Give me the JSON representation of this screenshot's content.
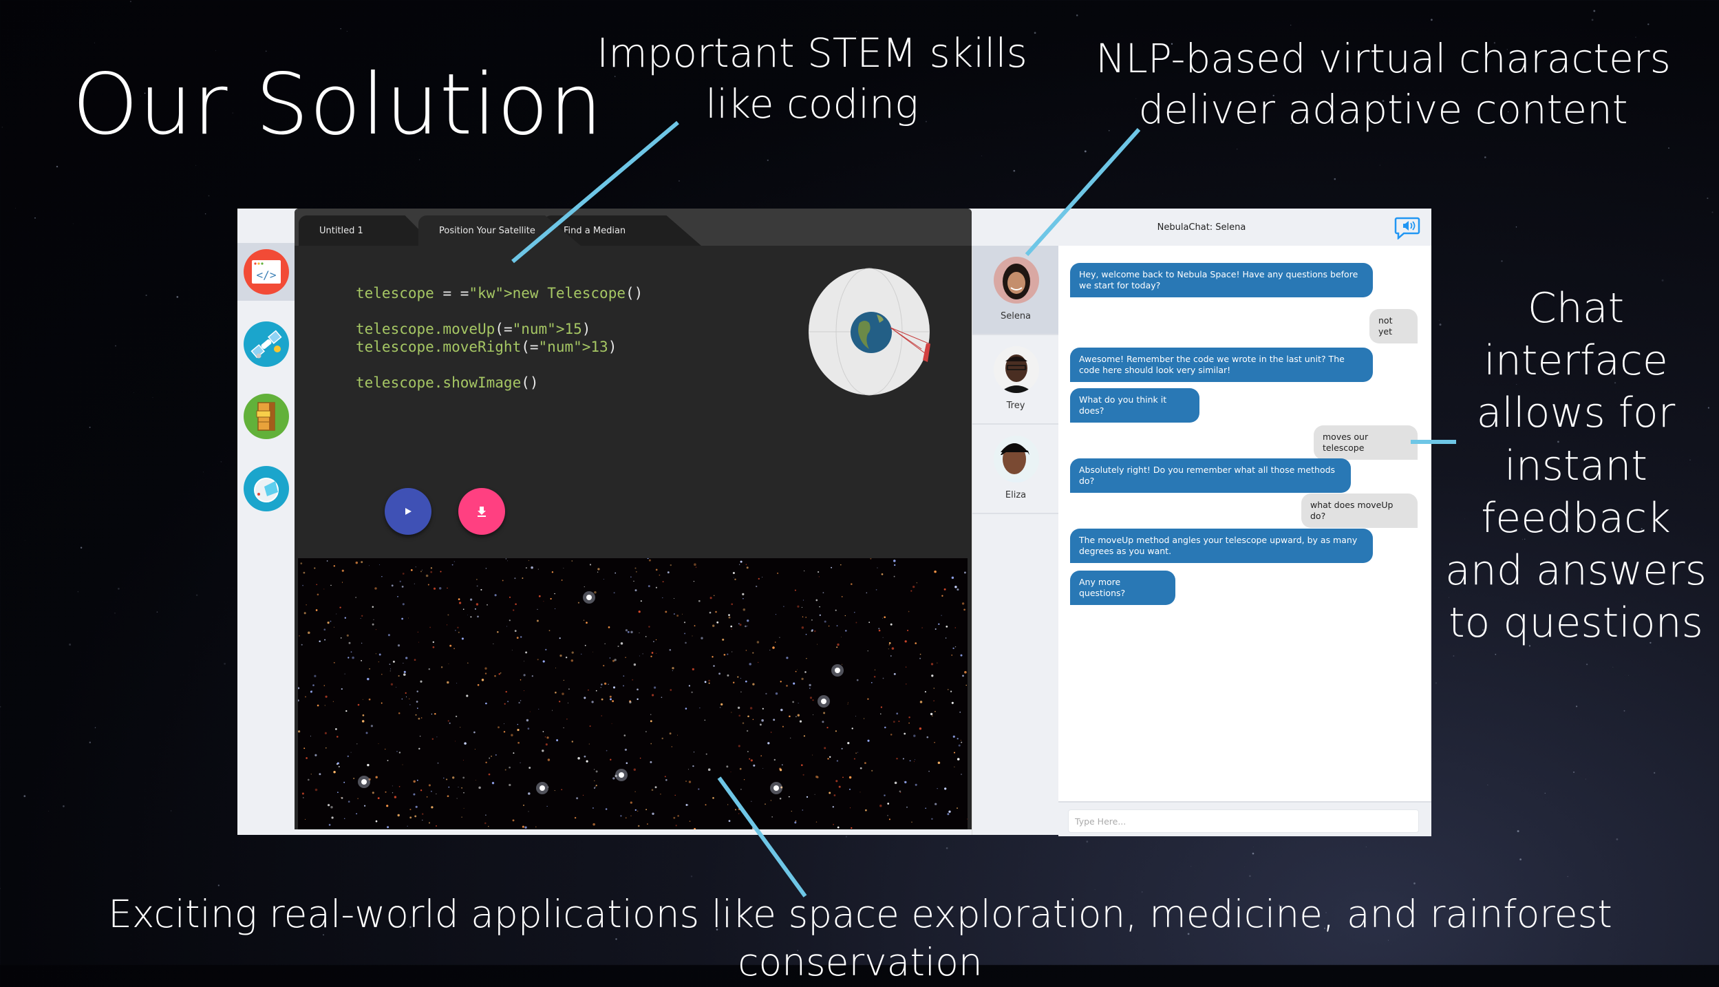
{
  "slide": {
    "title": "Our Solution",
    "callouts": {
      "stem": [
        "Important STEM skills",
        "like coding"
      ],
      "nlp": [
        "NLP-based virtual characters",
        "deliver adaptive content"
      ],
      "chat": [
        "Chat",
        "interface",
        "allows for",
        "instant",
        "feedback",
        "and answers",
        "to questions"
      ],
      "applications": "Exciting real-world applications like space exploration, medicine, and rainforest conservation"
    },
    "accent_color": "#6ec6e6"
  },
  "app": {
    "rail": [
      {
        "icon": "code-window-icon",
        "color": "#f24b36",
        "active": true
      },
      {
        "icon": "satellite-icon",
        "color": "#1ba5cc",
        "active": false
      },
      {
        "icon": "filing-cabinet-icon",
        "color": "#62b13a",
        "active": false
      },
      {
        "icon": "astronaut-helmet-icon",
        "color": "#1ba5cc",
        "active": false
      }
    ],
    "editor": {
      "tabs": [
        {
          "label": "Untitled 1",
          "active": false
        },
        {
          "label": "Position Your Satellite",
          "active": true
        },
        {
          "label": "Find a Median",
          "active": false
        }
      ],
      "code": [
        "telescope = new Telescope()",
        "",
        "telescope.moveUp(15)",
        "telescope.moveRight(13)",
        "",
        "telescope.showImage()"
      ],
      "run_button_icon": "play-icon",
      "download_button_icon": "download-icon",
      "run_color": "#3f51b5",
      "download_color": "#ff4081"
    },
    "chat": {
      "title": "NebulaChat: Selena",
      "characters": [
        {
          "name": "Selena",
          "active": true
        },
        {
          "name": "Trey",
          "active": false
        },
        {
          "name": "Eliza",
          "active": false
        }
      ],
      "messages": [
        {
          "from": "bot",
          "text": "Hey, welcome back to Nebula Space! Have any questions before we start for today?"
        },
        {
          "from": "user",
          "text": "not yet"
        },
        {
          "from": "bot",
          "text": "Awesome! Remember the code we wrote in the last unit? The code here should look very similar!"
        },
        {
          "from": "bot",
          "text": "What do you think it does?"
        },
        {
          "from": "user",
          "text": "moves our telescope"
        },
        {
          "from": "bot",
          "text": "Absolutely right! Do you remember what all those methods do?"
        },
        {
          "from": "user",
          "text": "what does moveUp do?"
        },
        {
          "from": "bot",
          "text": "The moveUp method angles your telescope upward, by as many degrees as you want."
        },
        {
          "from": "bot",
          "text": "Any more questions?"
        }
      ],
      "input_placeholder": "Type Here...",
      "bot_bubble_color": "#2978b5",
      "user_bubble_color": "#e1e1e1"
    }
  }
}
